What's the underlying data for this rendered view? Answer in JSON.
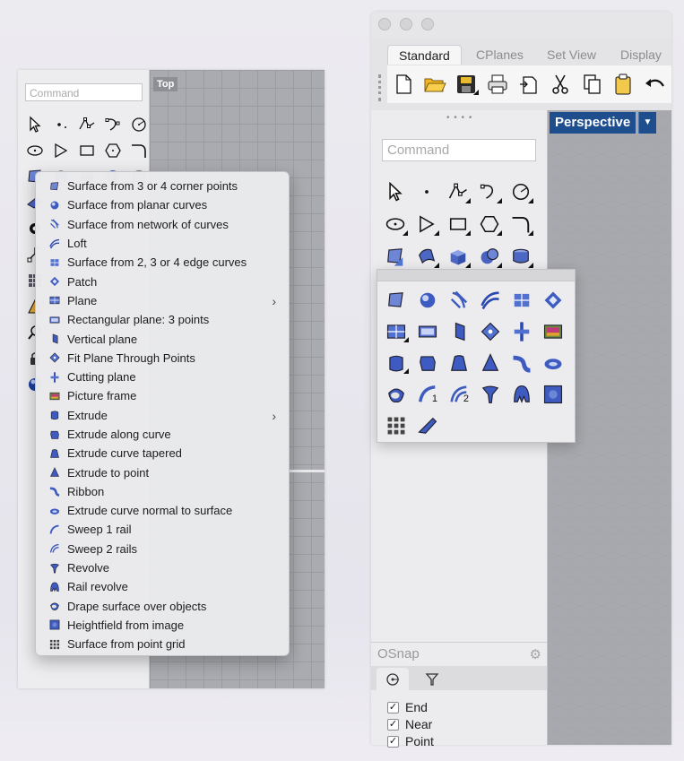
{
  "left_window": {
    "command_placeholder": "Command",
    "viewport_label": "Top",
    "tool_icons_row1": [
      "select-icon",
      "point-icon",
      "polyline-icon",
      "curve-icon",
      "circle-icon"
    ],
    "tool_icons_row2": [
      "ellipse-icon",
      "polygon-icon",
      "rectangle-icon",
      "hexagon-icon",
      "fillet-icon"
    ],
    "tool_icons_row3": [
      "surface-corner-icon",
      "surface-edge-icon",
      "solid-box-icon",
      "sphere-icon",
      "cylinder-icon"
    ],
    "tool_icons_column": [
      "plane-icon",
      "mesh-icon",
      "transform-icon",
      "array-icon",
      "analyze-icon",
      "zoom-icon",
      "lock-icon",
      "render-icon"
    ]
  },
  "menu": {
    "items": [
      {
        "label": "Surface from 3 or 4 corner points",
        "icon": "surface-corner-icon",
        "submenu": false
      },
      {
        "label": "Surface from planar curves",
        "icon": "planar-curve-icon",
        "submenu": false
      },
      {
        "label": "Surface from network of curves",
        "icon": "network-surface-icon",
        "submenu": false
      },
      {
        "label": "Loft",
        "icon": "loft-icon",
        "submenu": false
      },
      {
        "label": "Surface from 2, 3 or 4 edge curves",
        "icon": "edge-surface-icon",
        "submenu": false
      },
      {
        "label": "Patch",
        "icon": "patch-icon",
        "submenu": false
      },
      {
        "label": "Plane",
        "icon": "plane-icon",
        "submenu": true
      },
      {
        "label": "Rectangular plane: 3 points",
        "icon": "rect-plane-icon",
        "submenu": false
      },
      {
        "label": "Vertical plane",
        "icon": "vertical-plane-icon",
        "submenu": false
      },
      {
        "label": "Fit Plane Through Points",
        "icon": "fit-plane-icon",
        "submenu": false
      },
      {
        "label": "Cutting plane",
        "icon": "cutting-plane-icon",
        "submenu": false
      },
      {
        "label": "Picture frame",
        "icon": "picture-frame-icon",
        "submenu": false
      },
      {
        "label": "Extrude",
        "icon": "extrude-icon",
        "submenu": true
      },
      {
        "label": "Extrude along curve",
        "icon": "extrude-along-icon",
        "submenu": false
      },
      {
        "label": "Extrude curve tapered",
        "icon": "extrude-tapered-icon",
        "submenu": false
      },
      {
        "label": "Extrude to point",
        "icon": "extrude-point-icon",
        "submenu": false
      },
      {
        "label": "Ribbon",
        "icon": "ribbon-icon",
        "submenu": false
      },
      {
        "label": "Extrude curve normal to surface",
        "icon": "extrude-normal-icon",
        "submenu": false
      },
      {
        "label": "Sweep 1 rail",
        "icon": "sweep1-icon",
        "submenu": false
      },
      {
        "label": "Sweep 2 rails",
        "icon": "sweep2-icon",
        "submenu": false
      },
      {
        "label": "Revolve",
        "icon": "revolve-icon",
        "submenu": false
      },
      {
        "label": "Rail revolve",
        "icon": "rail-revolve-icon",
        "submenu": false
      },
      {
        "label": "Drape surface over objects",
        "icon": "drape-icon",
        "submenu": false
      },
      {
        "label": "Heightfield from image",
        "icon": "heightfield-icon",
        "submenu": false
      },
      {
        "label": "Surface from point grid",
        "icon": "point-grid-icon",
        "submenu": false
      }
    ]
  },
  "right_window": {
    "tabs": [
      "Standard",
      "CPlanes",
      "Set View",
      "Display"
    ],
    "active_tab": "Standard",
    "standard_toolbar_icons": [
      "new-file-icon",
      "open-folder-icon",
      "save-icon",
      "print-icon",
      "import-icon",
      "cut-icon",
      "copy-icon",
      "paste-icon",
      "undo-icon"
    ],
    "command_placeholder": "Command",
    "viewport_label": "Perspective",
    "viewport_dropdown_icon": "chevron-down-icon",
    "flyout_icons": [
      "surface-corner-icon",
      "planar-curve-icon",
      "network-surface-icon",
      "loft-icon",
      "edge-surface-icon",
      "patch-icon",
      "plane-icon",
      "rect-plane-icon",
      "vertical-plane-icon",
      "fit-plane-icon",
      "cutting-plane-icon",
      "picture-frame-icon",
      "extrude-icon",
      "extrude-along-icon",
      "extrude-tapered-icon",
      "extrude-point-icon",
      "ribbon-icon",
      "extrude-normal-icon",
      "drape-icon",
      "sweep1-icon",
      "sweep2-icon",
      "revolve-icon",
      "rail-revolve-icon",
      "heightfield-icon",
      "point-grid-icon",
      "slab-icon"
    ],
    "flyout_numbers": {
      "sweep1": "1",
      "sweep2": "2"
    }
  },
  "osnap": {
    "title": "OSnap",
    "gear_icon": "gear-icon",
    "tabs": [
      "osnap-target-icon",
      "filter-icon"
    ],
    "options": [
      {
        "label": "End",
        "checked": true
      },
      {
        "label": "Near",
        "checked": true
      },
      {
        "label": "Point",
        "checked": true
      }
    ]
  }
}
